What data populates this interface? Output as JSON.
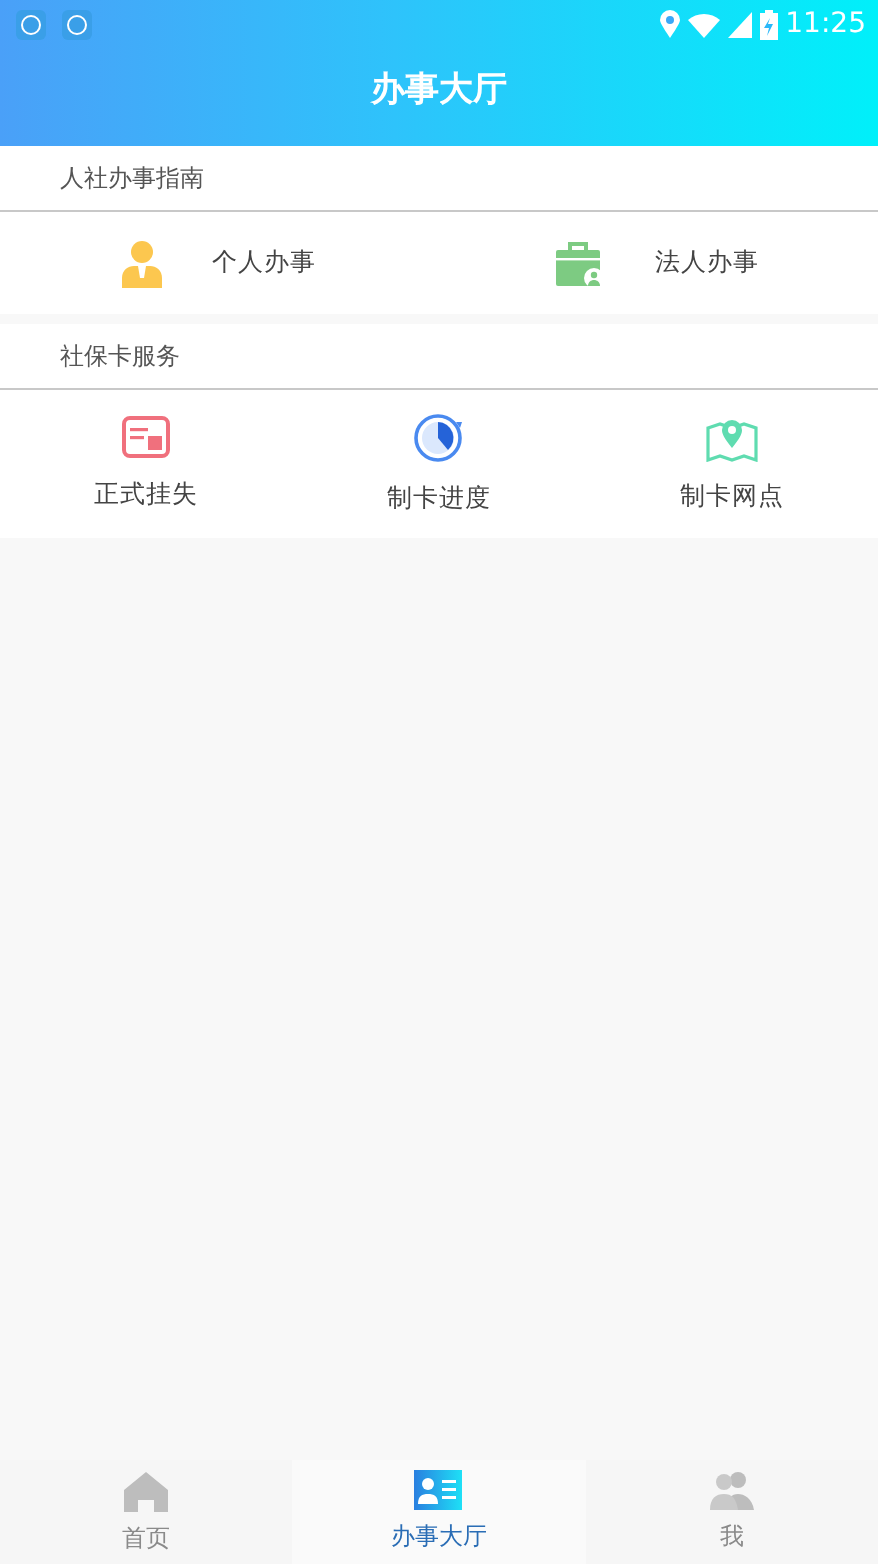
{
  "status_bar": {
    "time": "11:25"
  },
  "header": {
    "title": "办事大厅"
  },
  "sections": [
    {
      "title": "人社办事指南",
      "items": [
        {
          "label": "个人办事"
        },
        {
          "label": "法人办事"
        }
      ]
    },
    {
      "title": "社保卡服务",
      "items": [
        {
          "label": "正式挂失"
        },
        {
          "label": "制卡进度"
        },
        {
          "label": "制卡网点"
        }
      ]
    }
  ],
  "tabs": [
    {
      "label": "首页",
      "selected": false
    },
    {
      "label": "办事大厅",
      "selected": true
    },
    {
      "label": "我",
      "selected": false
    }
  ]
}
